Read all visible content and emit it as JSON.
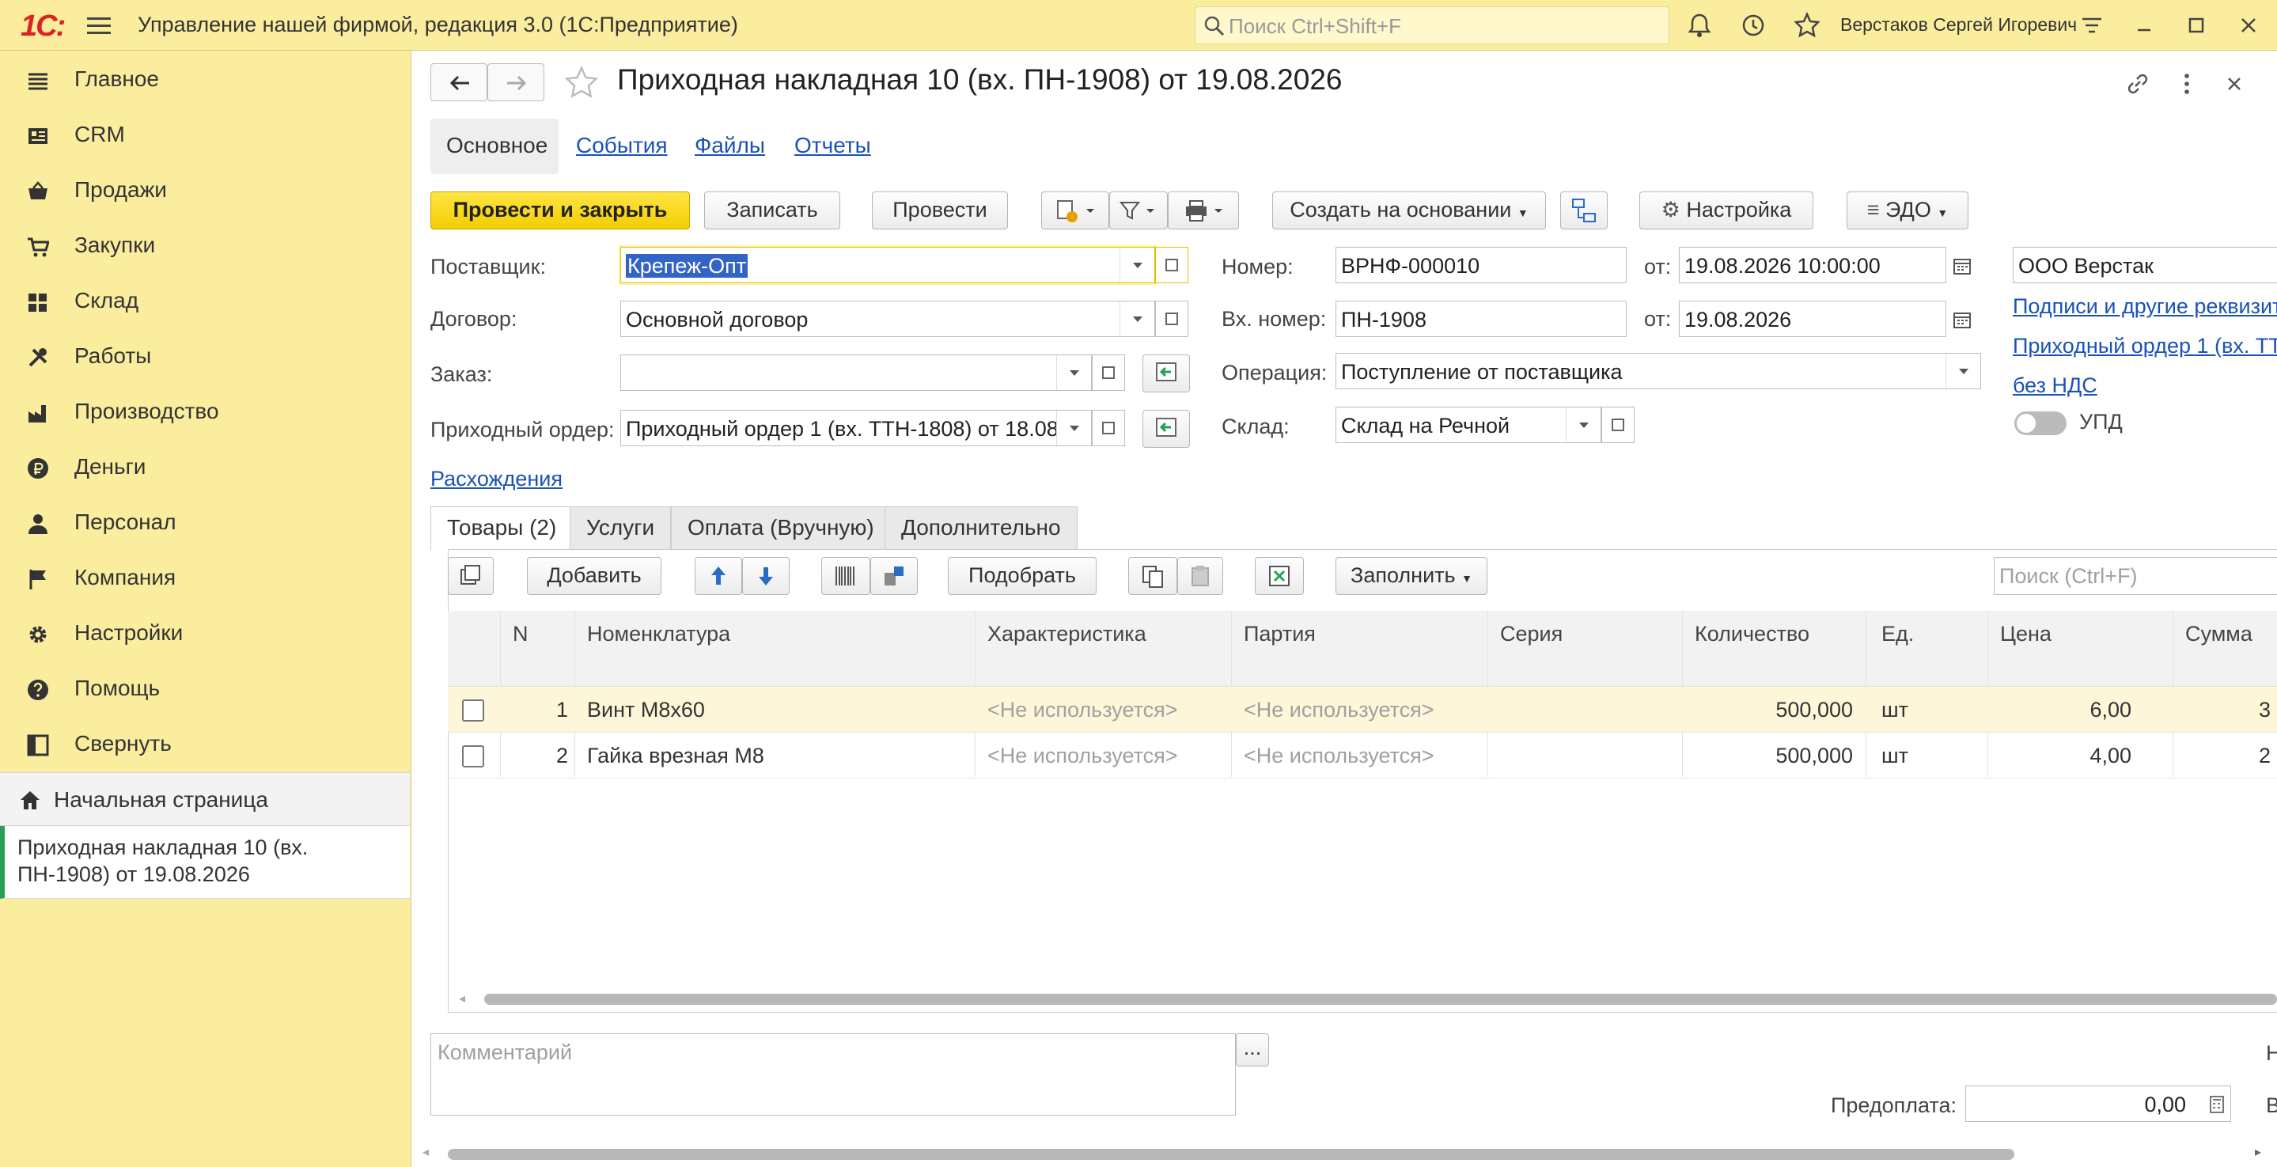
{
  "app": {
    "logo": "1С:",
    "title": "Управление нашей фирмой, редакция 3.0  (1С:Предприятие)",
    "search_placeholder": "Поиск Ctrl+Shift+F",
    "user": "Верстаков Сергей Игоревич"
  },
  "sidebar": {
    "items": [
      {
        "label": "Главное",
        "icon": "list-icon"
      },
      {
        "label": "CRM",
        "icon": "crm-icon"
      },
      {
        "label": "Продажи",
        "icon": "basket-icon"
      },
      {
        "label": "Закупки",
        "icon": "cart-icon"
      },
      {
        "label": "Склад",
        "icon": "grid-icon"
      },
      {
        "label": "Работы",
        "icon": "tools-icon"
      },
      {
        "label": "Производство",
        "icon": "factory-icon"
      },
      {
        "label": "Деньги",
        "icon": "ruble-icon"
      },
      {
        "label": "Персонал",
        "icon": "person-icon"
      },
      {
        "label": "Компания",
        "icon": "flag-icon"
      },
      {
        "label": "Настройки",
        "icon": "gear-icon"
      },
      {
        "label": "Помощь",
        "icon": "help-icon"
      },
      {
        "label": "Свернуть",
        "icon": "collapse-icon"
      }
    ],
    "home": "Начальная страница",
    "open_doc": "Приходная накладная 10 (вх. ПН-1908) от 19.08.2026"
  },
  "doc": {
    "title": "Приходная накладная 10 (вх. ПН-1908) от 19.08.2026",
    "tabs": [
      "Основное",
      "События",
      "Файлы",
      "Отчеты"
    ],
    "toolbar": {
      "post_close": "Провести и закрыть",
      "save": "Записать",
      "post": "Провести",
      "create_based": "Создать на основании",
      "settings": "Настройка",
      "edo": "ЭДО"
    },
    "fields": {
      "supplier_label": "Поставщик:",
      "supplier": "Крепеж-Опт",
      "contract_label": "Договор:",
      "contract": "Основной договор",
      "order_label": "Заказ:",
      "order": "",
      "receipt_label": "Приходный ордер:",
      "receipt": "Приходный ордер 1 (вх. ТТН-1808) от 18.08",
      "number_label": "Номер:",
      "number": "ВРНФ-000010",
      "from_label": "от:",
      "date": "19.08.2026 10:00:00",
      "in_number_label": "Вх. номер:",
      "in_number": "ПН-1908",
      "in_date": "19.08.2026",
      "operation_label": "Операция:",
      "operation": "Поступление от поставщика",
      "warehouse_label": "Склад:",
      "warehouse": "Склад на Речной",
      "company": "ООО Верстак",
      "link_signatures": "Подписи и другие реквизит",
      "link_receipt": "Приходный ордер 1 (вх. ТТ",
      "link_vat": "без НДС",
      "upd": "УПД",
      "discrepancies": "Расхождения"
    },
    "inner_tabs": [
      "Товары (2)",
      "Услуги",
      "Оплата (Вручную)",
      "Дополнительно"
    ],
    "table_toolbar": {
      "add": "Добавить",
      "pick": "Подобрать",
      "fill": "Заполнить",
      "search_placeholder": "Поиск (Ctrl+F)"
    },
    "columns": [
      "N",
      "Номенклатура",
      "Характеристика",
      "Партия",
      "Серия",
      "Количество",
      "Ед.",
      "Цена",
      "Сумма"
    ],
    "rows": [
      {
        "n": "1",
        "item": "Винт М8х60",
        "char": "<Не используется>",
        "batch": "<Не используется>",
        "series": "",
        "qty": "500,000",
        "unit": "шт",
        "price": "6,00",
        "sum": "3"
      },
      {
        "n": "2",
        "item": "Гайка врезная М8",
        "char": "<Не используется>",
        "batch": "<Не используется>",
        "series": "",
        "qty": "500,000",
        "unit": "шт",
        "price": "4,00",
        "sum": "2"
      }
    ],
    "comment_placeholder": "Комментарий",
    "comment_btn": "...",
    "prepay_label": "Предоплата:",
    "prepay": "0,00",
    "right_edge_1": "Н",
    "right_edge_2": "В"
  }
}
